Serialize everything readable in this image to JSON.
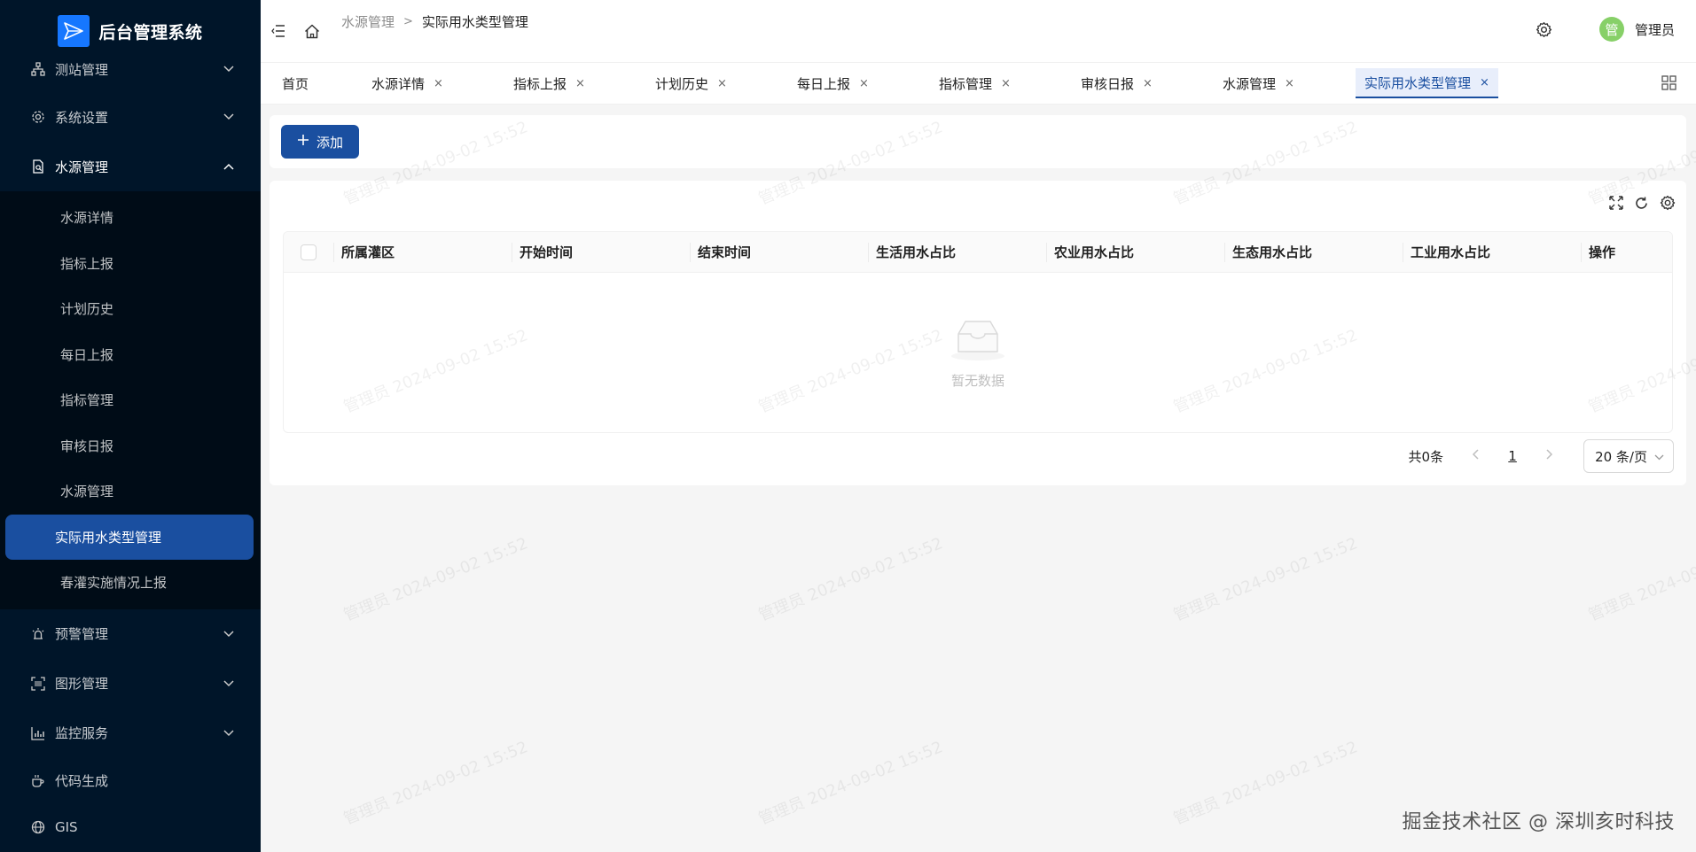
{
  "app": {
    "title": "后台管理系统"
  },
  "sidebar": {
    "items_top": [
      {
        "label": "测站管理"
      },
      {
        "label": "系统设置"
      },
      {
        "label": "水源管理"
      }
    ],
    "submenu": [
      {
        "label": "水源详情"
      },
      {
        "label": "指标上报"
      },
      {
        "label": "计划历史"
      },
      {
        "label": "每日上报"
      },
      {
        "label": "指标管理"
      },
      {
        "label": "审核日报"
      },
      {
        "label": "水源管理"
      },
      {
        "label": "实际用水类型管理"
      },
      {
        "label": "春灌实施情况上报"
      }
    ],
    "items_bottom": [
      {
        "label": "预警管理"
      },
      {
        "label": "图形管理"
      },
      {
        "label": "监控服务"
      },
      {
        "label": "代码生成"
      },
      {
        "label": "GIS"
      }
    ]
  },
  "header": {
    "breadcrumb": {
      "parent": "水源管理",
      "separator": ">",
      "current": "实际用水类型管理"
    },
    "avatar_char": "管",
    "username": "管理员"
  },
  "tabs": [
    {
      "label": "首页"
    },
    {
      "label": "水源详情",
      "close": "×"
    },
    {
      "label": "指标上报",
      "close": "×"
    },
    {
      "label": "计划历史",
      "close": "×"
    },
    {
      "label": "每日上报",
      "close": "×"
    },
    {
      "label": "指标管理",
      "close": "×"
    },
    {
      "label": "审核日报",
      "close": "×"
    },
    {
      "label": "水源管理",
      "close": "×"
    },
    {
      "label": "实际用水类型管理",
      "close": "×"
    }
  ],
  "toolbar": {
    "add_label": "添加"
  },
  "table": {
    "columns": [
      "所属灌区",
      "开始时间",
      "结束时间",
      "生活用水占比",
      "农业用水占比",
      "生态用水占比",
      "工业用水占比",
      "操作"
    ],
    "empty_text": "暂无数据"
  },
  "pagination": {
    "total": "共0条",
    "current_page": "1",
    "page_size": "20 条/页"
  },
  "watermark": "管理员 2024-09-02 15:52",
  "footer_brand": "掘金技术社区 @ 深圳亥时科技",
  "colors": {
    "sidebar_bg": "#001529",
    "primary": "#1a4fa0",
    "avatar_bg": "#87d068"
  }
}
